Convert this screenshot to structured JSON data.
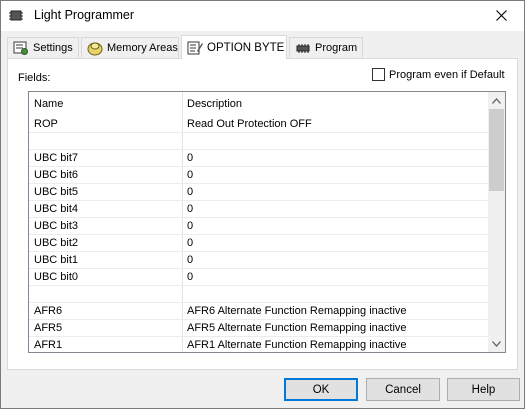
{
  "window": {
    "title": "Light Programmer"
  },
  "tabs": [
    {
      "label": "Settings",
      "icon": "settings-icon"
    },
    {
      "label": "Memory Areas",
      "icon": "memory-areas-icon"
    },
    {
      "label": "OPTION BYTE",
      "icon": "option-byte-icon"
    },
    {
      "label": "Program",
      "icon": "chip-icon"
    }
  ],
  "active_tab": "OPTION BYTE",
  "panel": {
    "fields_label": "Fields:",
    "program_default": {
      "label": "Program even if Default",
      "checked": false
    }
  },
  "table": {
    "columns": [
      "Name",
      "Description"
    ],
    "rows": [
      {
        "name": "ROP",
        "desc": "Read Out Protection OFF"
      },
      {
        "name": "",
        "desc": ""
      },
      {
        "name": "UBC bit7",
        "desc": "0"
      },
      {
        "name": "UBC bit6",
        "desc": "0"
      },
      {
        "name": "UBC bit5",
        "desc": "0"
      },
      {
        "name": "UBC bit4",
        "desc": "0"
      },
      {
        "name": "UBC bit3",
        "desc": "0"
      },
      {
        "name": "UBC bit2",
        "desc": "0"
      },
      {
        "name": "UBC bit1",
        "desc": "0"
      },
      {
        "name": "UBC bit0",
        "desc": "0"
      },
      {
        "name": "",
        "desc": ""
      },
      {
        "name": "AFR6",
        "desc": "AFR6 Alternate Function Remapping inactive"
      },
      {
        "name": "AFR5",
        "desc": "AFR5 Alternate Function Remapping inactive"
      },
      {
        "name": "AFR1",
        "desc": "AFR1 Alternate Function Remapping inactive"
      }
    ]
  },
  "buttons": {
    "ok": "OK",
    "cancel": "Cancel",
    "help": "Help"
  },
  "colors": {
    "accent": "#0078d7",
    "window_bg": "#f0f0f0",
    "panel_bg": "#ffffff"
  }
}
